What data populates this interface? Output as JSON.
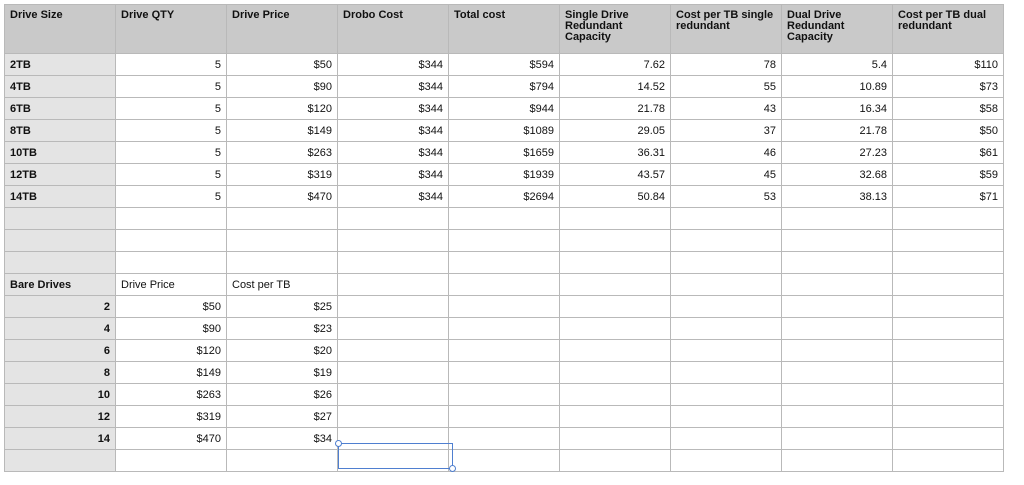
{
  "header": [
    "Drive Size",
    "Drive QTY",
    "Drive Price",
    "Drobo Cost",
    "Total cost",
    "Single Drive Redundant Capacity",
    "Cost per TB single redundant",
    "Dual Drive Redundant Capacity",
    "Cost per TB dual redundant"
  ],
  "rows": [
    [
      "2TB",
      "5",
      "$50",
      "$344",
      "$594",
      "7.62",
      "78",
      "5.4",
      "$110"
    ],
    [
      "4TB",
      "5",
      "$90",
      "$344",
      "$794",
      "14.52",
      "55",
      "10.89",
      "$73"
    ],
    [
      "6TB",
      "5",
      "$120",
      "$344",
      "$944",
      "21.78",
      "43",
      "16.34",
      "$58"
    ],
    [
      "8TB",
      "5",
      "$149",
      "$344",
      "$1089",
      "29.05",
      "37",
      "21.78",
      "$50"
    ],
    [
      "10TB",
      "5",
      "$263",
      "$344",
      "$1659",
      "36.31",
      "46",
      "27.23",
      "$61"
    ],
    [
      "12TB",
      "5",
      "$319",
      "$344",
      "$1939",
      "43.57",
      "45",
      "32.68",
      "$59"
    ],
    [
      "14TB",
      "5",
      "$470",
      "$344",
      "$2694",
      "50.84",
      "53",
      "38.13",
      "$71"
    ]
  ],
  "bare": {
    "header": [
      "Bare Drives",
      "Drive Price",
      "Cost per TB"
    ],
    "rows": [
      [
        "2",
        "$50",
        "$25"
      ],
      [
        "4",
        "$90",
        "$23"
      ],
      [
        "6",
        "$120",
        "$20"
      ],
      [
        "8",
        "$149",
        "$19"
      ],
      [
        "10",
        "$263",
        "$26"
      ],
      [
        "12",
        "$319",
        "$27"
      ],
      [
        "14",
        "$470",
        "$34"
      ]
    ]
  }
}
